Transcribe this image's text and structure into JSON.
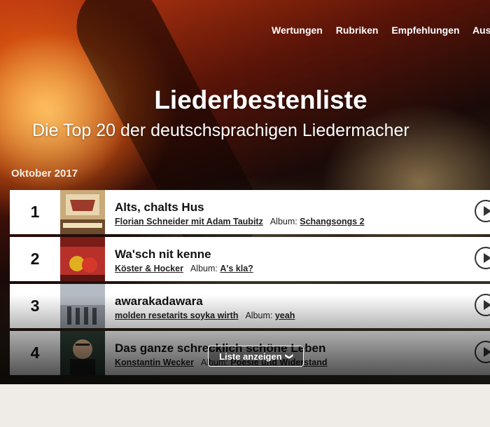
{
  "nav": {
    "items": [
      "Wertungen",
      "Rubriken",
      "Empfehlungen",
      "Auszeichnungen"
    ]
  },
  "hero": {
    "title": "Liederbestenliste",
    "subtitle": "Die Top 20 der deutschsprachigen Liedermacher"
  },
  "month": "Oktober 2017",
  "album_label": "Album:",
  "entries": [
    {
      "rank": "1",
      "song": "Alts, chalts Hus",
      "artist": "Florian Schneider mit Adam Taubitz",
      "album": "Schangsongs 2"
    },
    {
      "rank": "2",
      "song": "Wa'sch nit kenne",
      "artist": "Köster & Hocker",
      "album": "A's kla?"
    },
    {
      "rank": "3",
      "song": "awarakadawara",
      "artist": "molden resetarits soyka wirth",
      "album": "yeah"
    },
    {
      "rank": "4",
      "song": "Das ganze schrecklich schöne Leben",
      "artist": "Konstantin Wecker",
      "album": "Poesie und Widerstand"
    }
  ],
  "show_list_button": "Liste anzeigen",
  "colors": {
    "accent_text": "#111111",
    "row_bg": "#ffffff",
    "page_bg": "#efebe7"
  }
}
